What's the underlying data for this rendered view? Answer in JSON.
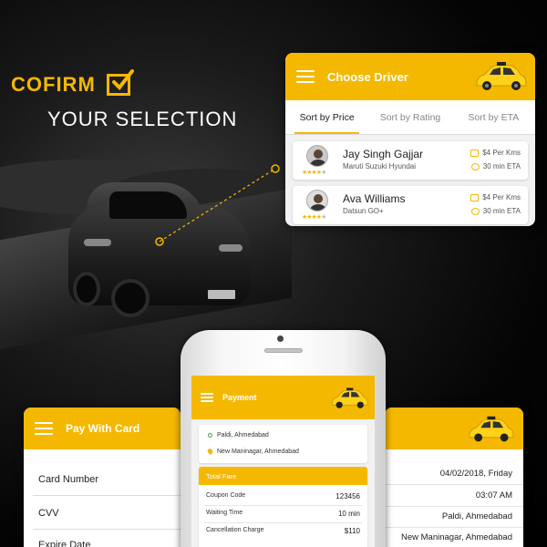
{
  "hero": {
    "line1": "COFIRM",
    "line2": "YOUR SELECTION"
  },
  "colors": {
    "accent": "#f5b800",
    "dark": "#000000"
  },
  "choose_driver": {
    "title": "Choose Driver",
    "tabs": [
      "Sort by Price",
      "Sort by Rating",
      "Sort by ETA"
    ],
    "active_tab": "Sort by Price",
    "drivers": [
      {
        "name": "Jay Singh Gajjar",
        "car": "Maruti Suzuki Hyundai",
        "price": "$4 Per Kms",
        "eta": "30 min ETA",
        "rating": 3.5
      },
      {
        "name": "Ava Williams",
        "car": "Datsun GO+",
        "price": "$4 Per Kms",
        "eta": "30 min ETA",
        "rating": 3.5
      }
    ]
  },
  "payment": {
    "title": "Payment",
    "from": "Paldi, Ahmedabad",
    "to": "New Maninagar, Ahmedabad",
    "fare_title": "Total Fare",
    "rows": [
      {
        "label": "Coupon Code",
        "value": "123456"
      },
      {
        "label": "Waiting Time",
        "value": "10 min"
      },
      {
        "label": "Cancellation Charge",
        "value": "$110"
      }
    ]
  },
  "pay_with_card": {
    "title": "Pay With Card",
    "fields": [
      "Card Number",
      "CVV",
      "Expire Date"
    ]
  },
  "details": {
    "date": "04/02/2018, Friday",
    "time": "03:07 AM",
    "from": "Paldi, Ahmedabad",
    "to": "New Maninagar, Ahmedabad"
  },
  "icons": {
    "menu": "hamburger-menu-icon",
    "taxi": "taxi-car-icon",
    "check": "checkmark-icon",
    "price": "money-icon",
    "eta": "clock-icon",
    "origin": "origin-dot-icon",
    "destination": "location-pin-icon"
  }
}
